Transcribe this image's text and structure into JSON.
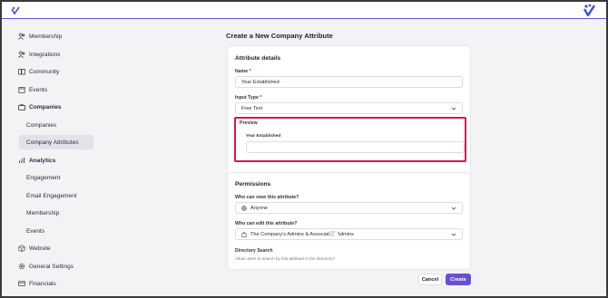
{
  "colors": {
    "accent": "#6b4fd3",
    "preview_highlight": "#d8174a",
    "sidebar_active_bg": "#e2e3ea"
  },
  "sidebar": {
    "items": [
      {
        "label": "Membership",
        "icon": "users-icon"
      },
      {
        "label": "Integrations",
        "icon": "users-icon"
      },
      {
        "label": "Community",
        "icon": "book-icon"
      },
      {
        "label": "Events",
        "icon": "calendar-icon"
      },
      {
        "label": "Companies",
        "icon": "briefcase-icon"
      },
      {
        "label": "Companies"
      },
      {
        "label": "Company Attributes"
      },
      {
        "label": "Analytics",
        "icon": "bar-chart-icon"
      },
      {
        "label": "Engagement"
      },
      {
        "label": "Email Engagement"
      },
      {
        "label": "Membership"
      },
      {
        "label": "Events"
      },
      {
        "label": "Website",
        "icon": "cube-icon"
      },
      {
        "label": "General Settings",
        "icon": "gear-icon"
      },
      {
        "label": "Financials",
        "icon": "card-icon"
      }
    ]
  },
  "main": {
    "title": "Create a New Company Attribute",
    "details": {
      "heading": "Attribute details",
      "name_label": "Name",
      "required_mark": "*",
      "name_value": "Year Established",
      "input_type_label": "Input Type",
      "input_type_value": "Free Text",
      "preview_label": "Preview",
      "preview_field_label": "Year Established",
      "preview_field_value": ""
    },
    "permissions": {
      "heading": "Permissions",
      "view_label": "Who can view this attribute?",
      "view_value": "Anyone",
      "edit_label": "Who can edit this attribute?",
      "edit_value": "The Company's Admins & Association Admins",
      "directory_label": "Directory Search",
      "directory_help": "Allow users to search by this attribute in the directory?",
      "directory_enabled": false
    },
    "buttons": {
      "cancel": "Cancel",
      "create": "Create"
    }
  }
}
